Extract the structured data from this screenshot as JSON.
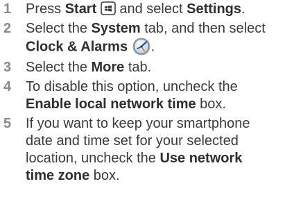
{
  "steps": [
    {
      "num": "1",
      "t1": "Press ",
      "b1": "Start",
      "t2": " and select ",
      "b2": "Settings",
      "t3": "."
    },
    {
      "num": "2",
      "t1": "Select the ",
      "b1": "System",
      "t2": " tab, and then select",
      "b2": "Clock & Alarms",
      "t3": "."
    },
    {
      "num": "3",
      "t1": "Select the ",
      "b1": "More",
      "t2": " tab."
    },
    {
      "num": "4",
      "l1": "To disable this option, uncheck the",
      "b1": "Enable local network time",
      "t2": " box."
    },
    {
      "num": "5",
      "l1": "If you want to keep your smartphone",
      "l2": "date and time set for your selected",
      "t3": "location, uncheck the ",
      "b1": "Use network",
      "b2": "time zone",
      "t4": " box."
    }
  ],
  "icons": {
    "start": "windows-start-key-icon",
    "clock": "clock-alarms-icon"
  }
}
